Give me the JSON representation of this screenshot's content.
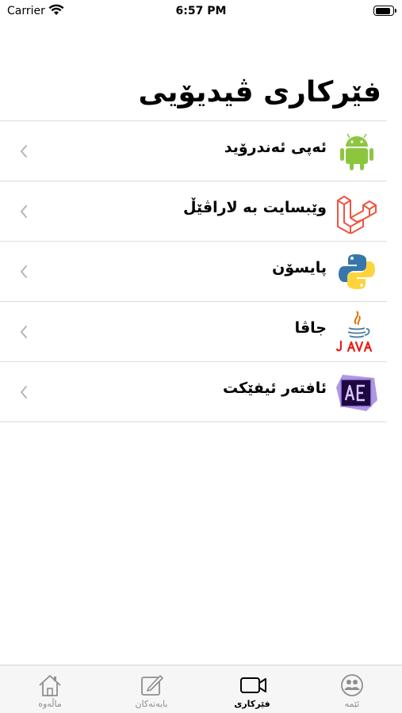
{
  "status_bar": {
    "carrier": "Carrier",
    "time": "6:57 PM",
    "battery_level": 0.9
  },
  "page": {
    "title": "فێرکاری ڤیدیۆیی"
  },
  "courses": [
    {
      "label": "ئەپی ئەندرۆید",
      "icon": "android-icon",
      "color": "#8cc63f"
    },
    {
      "label": "وێبسایت بە لاراڤێڵ",
      "icon": "laravel-icon",
      "color": "#f05340"
    },
    {
      "label": "پایسۆن",
      "icon": "python-icon",
      "color": "#3776ab"
    },
    {
      "label": "جاڤا",
      "icon": "java-icon",
      "color": "#e76f00"
    },
    {
      "label": "ئافتەر ئیفێکت",
      "icon": "after-effects-icon",
      "color": "#1f0740"
    }
  ],
  "tab_bar": {
    "tabs": [
      {
        "label": "ئێمە",
        "icon": "users-icon",
        "active": false
      },
      {
        "label": "فێرکاری",
        "icon": "video-icon",
        "active": true
      },
      {
        "label": "بابەتەکان",
        "icon": "edit-icon",
        "active": false
      },
      {
        "label": "ماڵەوە",
        "icon": "home-icon",
        "active": false
      }
    ]
  }
}
